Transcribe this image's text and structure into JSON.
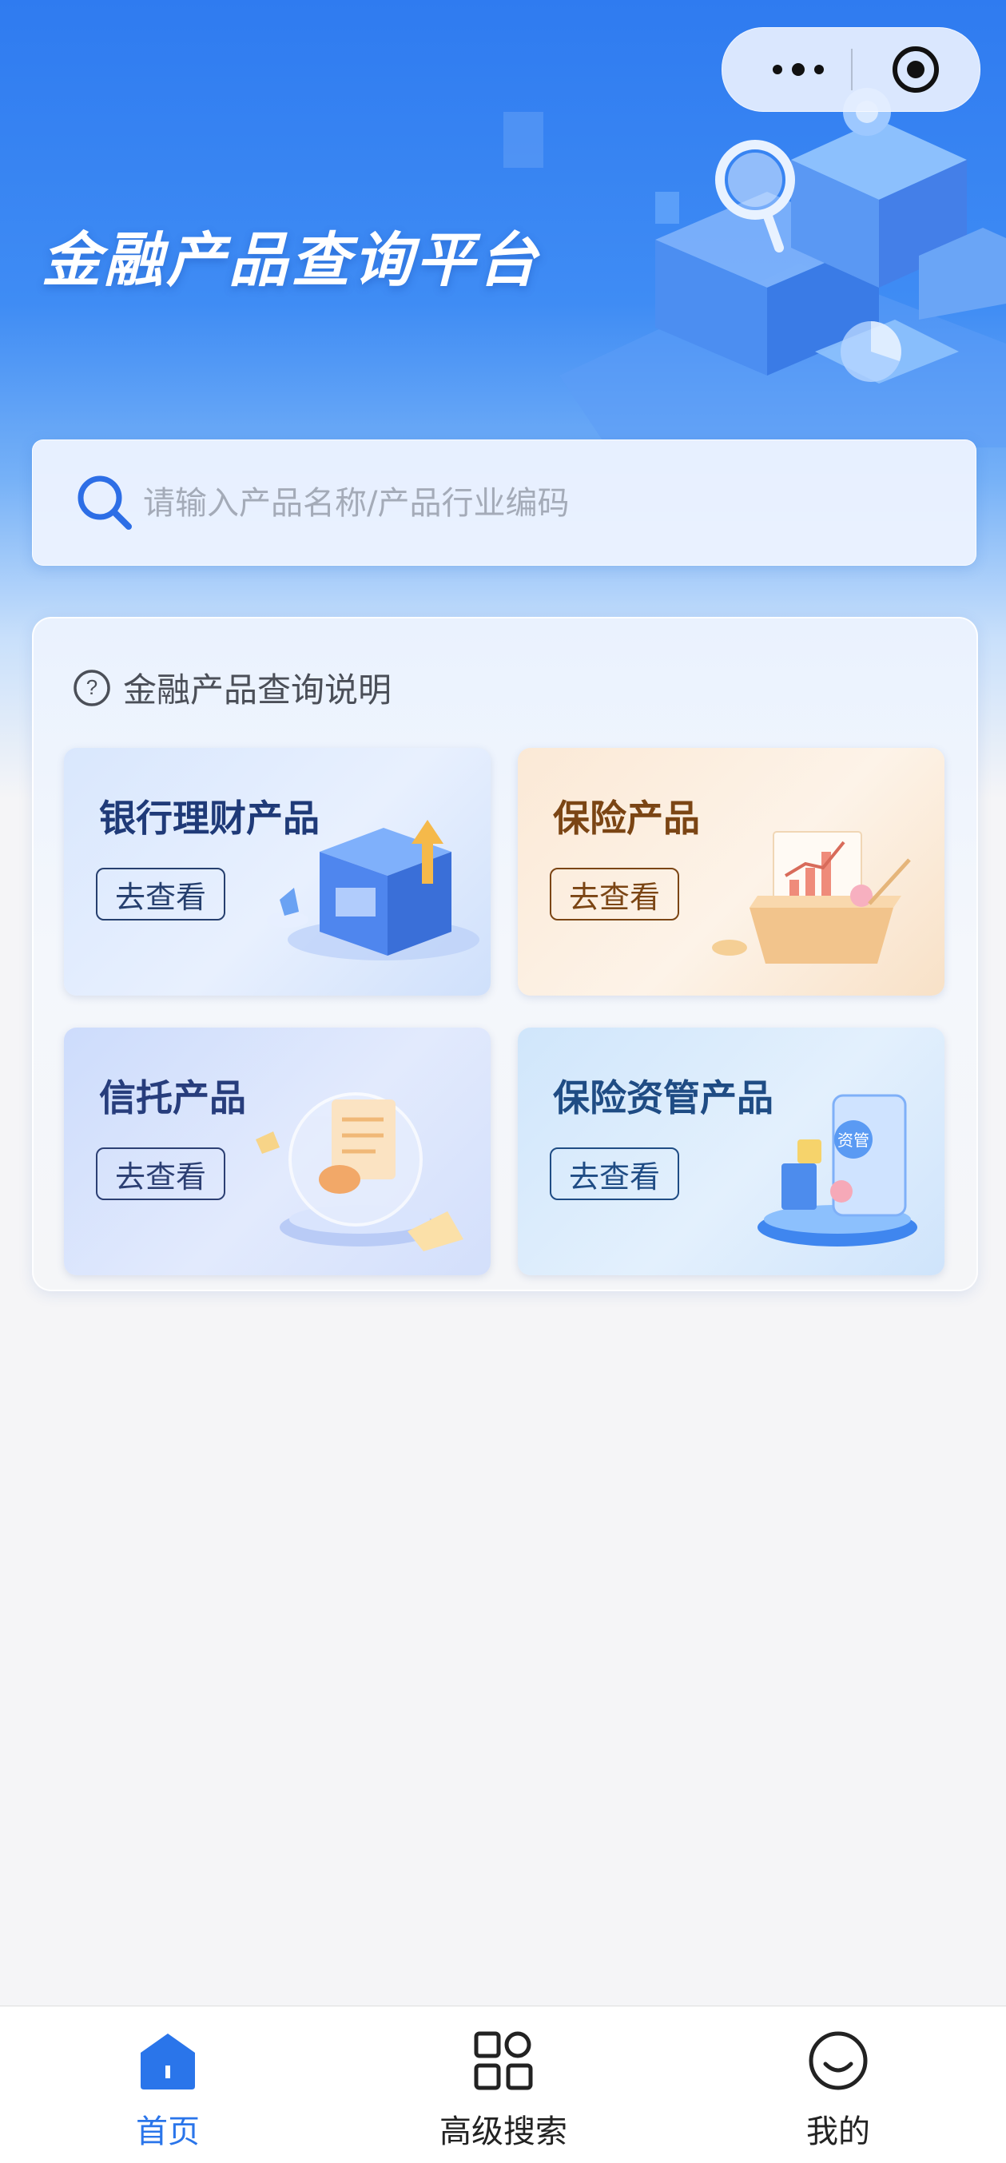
{
  "header": {
    "title": "金融产品查询平台"
  },
  "capsule": {
    "more_icon": "more-dots-icon",
    "close_icon": "target-circle-icon"
  },
  "search": {
    "placeholder": "请输入产品名称/产品行业编码",
    "value": ""
  },
  "help": {
    "label": "金融产品查询说明"
  },
  "products": [
    {
      "title": "银行理财产品",
      "button": "去查看"
    },
    {
      "title": "保险产品",
      "button": "去查看"
    },
    {
      "title": "信托产品",
      "button": "去查看"
    },
    {
      "title": "保险资管产品",
      "button": "去查看"
    }
  ],
  "tabbar": {
    "items": [
      {
        "label": "首页",
        "icon": "home-icon",
        "active": true
      },
      {
        "label": "高级搜索",
        "icon": "grid-icon",
        "active": false
      },
      {
        "label": "我的",
        "icon": "smiley-icon",
        "active": false
      }
    ],
    "active_color": "#2a75ea"
  }
}
